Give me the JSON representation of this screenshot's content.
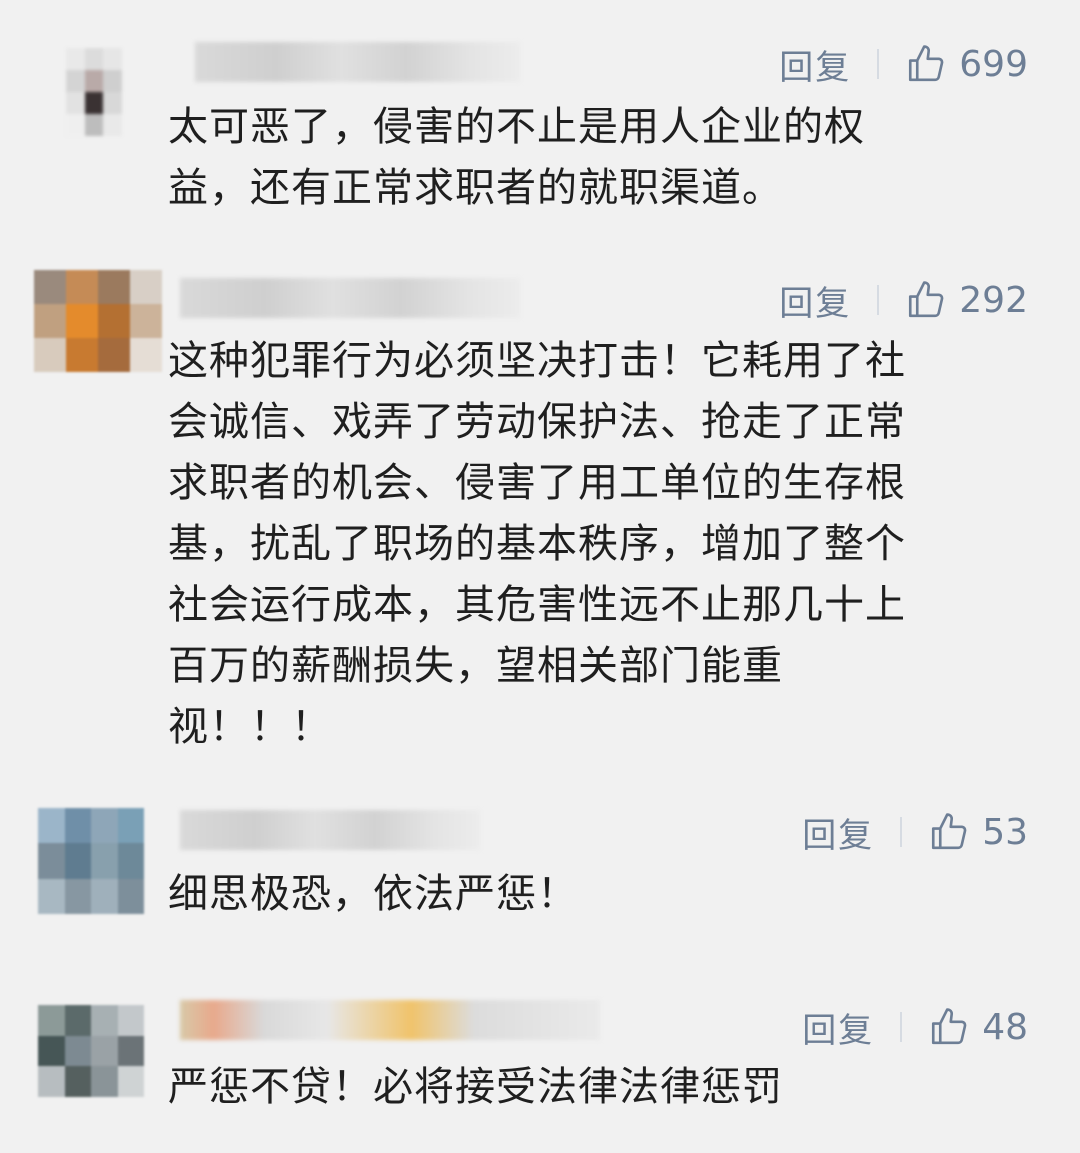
{
  "comments": [
    {
      "reply_label": "回复",
      "likes": "699",
      "lines": [
        "太可恶了，侵害的不止是用人企业的权",
        "益，还有正常求职者的就职渠道。"
      ],
      "avatar_colors": [
        "#e9e9e9",
        "#dcdcdc",
        "#e6e6e6",
        "#d4d4d4",
        "#b9aaa8",
        "#cfcfcf",
        "#e2e2e2",
        "#3a3233",
        "#d8d8d8",
        "#efefef",
        "#bdbdbd",
        "#e9e9e9"
      ]
    },
    {
      "reply_label": "回复",
      "likes": "292",
      "lines": [
        "这种犯罪行为必须坚决打击！它耗用了社",
        "会诚信、戏弄了劳动保护法、抢走了正常",
        "求职者的机会、侵害了用工单位的生存根",
        "基，扰乱了职场的基本秩序，增加了整个",
        "社会运行成本，其危害性远不止那几十上",
        "百万的薪酬损失，望相关部门能重",
        "视！！！"
      ],
      "avatar_colors": [
        "#9a8a7d",
        "#c58b56",
        "#9b7a5e",
        "#d8cfc6",
        "#c0a080",
        "#e48b2c",
        "#b47032",
        "#ccb39a",
        "#d8cbbd",
        "#c87a30",
        "#a56b3d",
        "#e5ddd5"
      ]
    },
    {
      "reply_label": "回复",
      "likes": "53",
      "lines": [
        "细思极恐，依法严惩！"
      ],
      "avatar_colors": [
        "#9bb5c9",
        "#6f8fa8",
        "#8ea6b8",
        "#7aa0b6",
        "#7b8d9a",
        "#5f7c90",
        "#88a0ad",
        "#6d8999",
        "#a8b8c2",
        "#8797a2",
        "#9fb0bb",
        "#7d8f9b"
      ]
    },
    {
      "reply_label": "回复",
      "likes": "48",
      "lines": [
        "严惩不贷！必将接受法律法律惩罚"
      ],
      "avatar_colors": [
        "#8c9a98",
        "#5b6a6a",
        "#a7b0b3",
        "#c3c8cb",
        "#465656",
        "#7d8a92",
        "#9aa2a6",
        "#6b7377",
        "#b7bdc0",
        "#55605f",
        "#8a9498",
        "#cfd3d4"
      ]
    }
  ]
}
